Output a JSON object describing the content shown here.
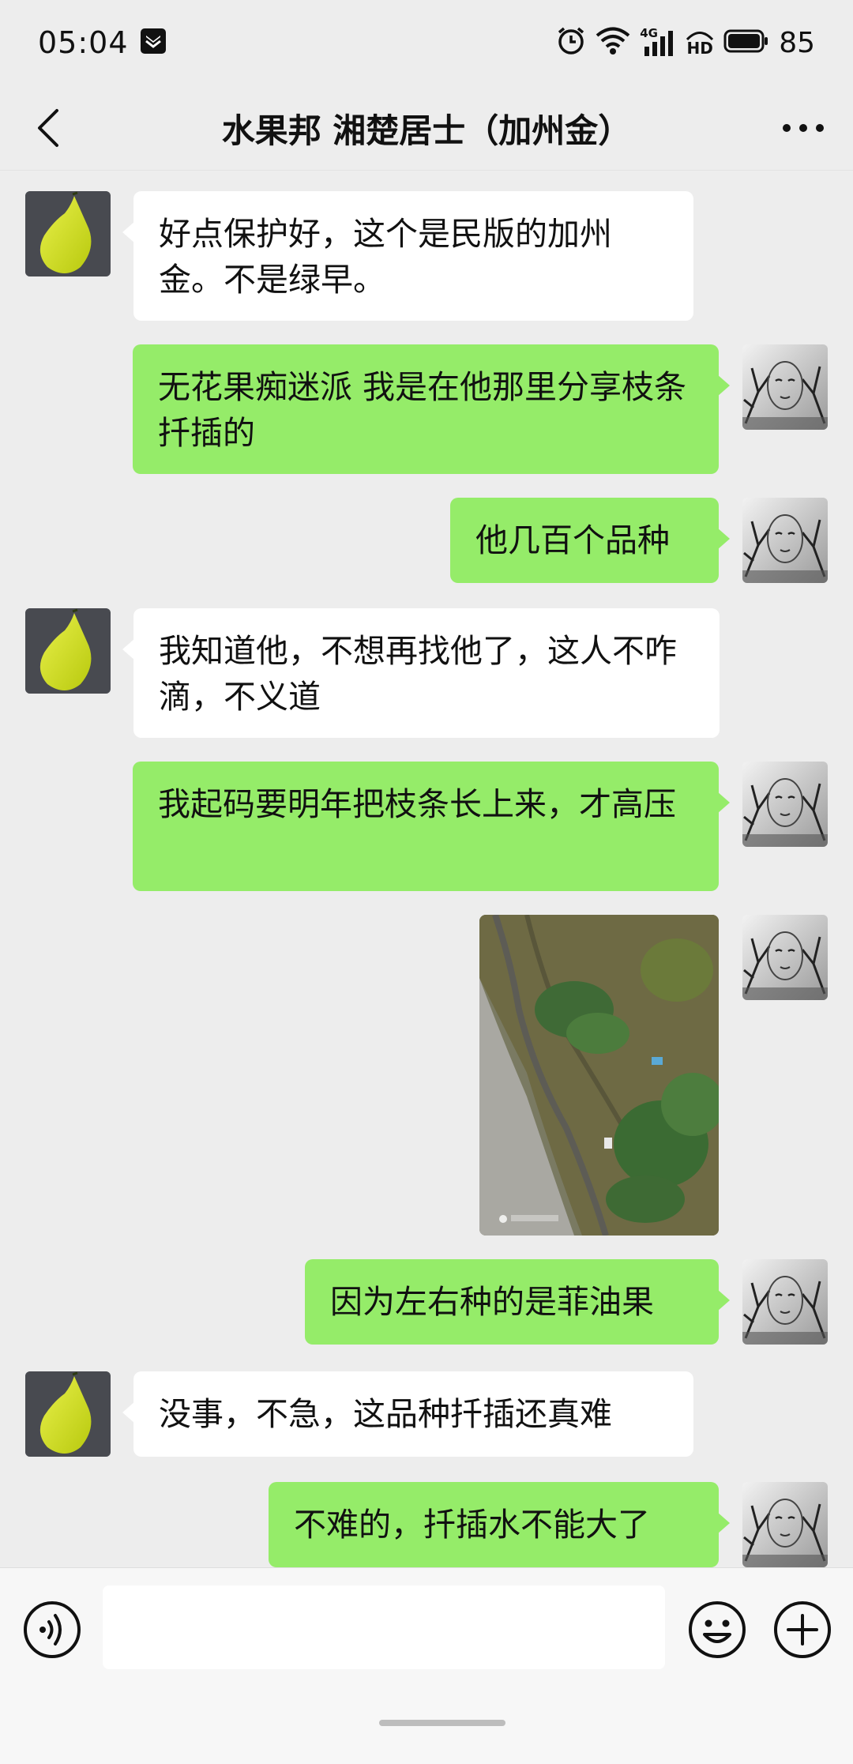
{
  "status_bar": {
    "time": "05:04",
    "network_label": "4G",
    "hd_label": "HD",
    "battery_level": "85"
  },
  "header": {
    "title": "水果邦  湘楚居士（加州金）"
  },
  "messages": [
    {
      "side": "left",
      "text": "好点保护好，这个是民版的加州金。不是绿早。"
    },
    {
      "side": "right",
      "text": "无花果痴迷派 我是在他那里分享枝条扦插的"
    },
    {
      "side": "right",
      "text": "他几百个品种"
    },
    {
      "side": "left",
      "text": "我知道他，不想再找他了，这人不咋滴，不义道"
    },
    {
      "side": "right",
      "text": "我起码要明年把枝条长上来，才高压"
    },
    {
      "side": "right",
      "type": "image",
      "text": ""
    },
    {
      "side": "right",
      "text": "因为左右种的是菲油果"
    },
    {
      "side": "left",
      "text": "没事，不急，这品种扦插还真难"
    },
    {
      "side": "right",
      "text": "不难的，扦插水不能大了"
    }
  ],
  "input": {
    "value": "",
    "placeholder": ""
  },
  "icons": {
    "back": "chevron-left-icon",
    "more": "more-dots-icon",
    "voice": "voice-icon",
    "emoji": "emoji-icon",
    "plus": "plus-icon"
  },
  "colors": {
    "background": "#ededed",
    "sent_bubble": "#95ec69",
    "received_bubble": "#ffffff"
  }
}
